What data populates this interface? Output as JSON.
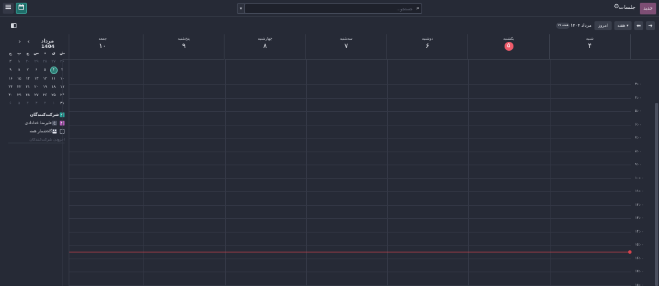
{
  "topbar": {
    "new_label": "جدید",
    "app_title": "جلسات",
    "settings_icon": "gear-icon",
    "search_placeholder": "جستجو...",
    "search_icon": "search-icon",
    "search_toggle_icon": "caret-down-icon",
    "views": [
      {
        "name": "calendar-view",
        "icon": "calendar-icon",
        "active": true
      },
      {
        "name": "list-view",
        "icon": "list-icon",
        "active": false
      }
    ]
  },
  "controls": {
    "prev_icon": "arrow-left-icon",
    "next_icon": "arrow-right-icon",
    "scale_label": "هفته",
    "today_label": "امروز",
    "range_label": "مرداد ۱۴۰۴",
    "week_badge": "هفته ۱۹",
    "sidebar_toggle_icon": "sidebar-toggle-icon"
  },
  "mini_calendar": {
    "title": "مرداد 1404",
    "weekday_heads": [
      "ش",
      "ی",
      "د",
      "س",
      "چ",
      "پ",
      "ج"
    ],
    "weeks": [
      [
        "۲۶",
        "۲۷",
        "۲۸",
        "۲۹",
        "۳۰",
        "۱",
        "۲"
      ],
      [
        "۳",
        "۴",
        "۵",
        "۶",
        "۷",
        "۸",
        "۹"
      ],
      [
        "۱۰",
        "۱۱",
        "۱۲",
        "۱۳",
        "۱۴",
        "۱۵",
        "۱۶"
      ],
      [
        "۱۷",
        "۱۸",
        "۱۹",
        "۲۰",
        "۲۱",
        "۲۲",
        "۲۳"
      ],
      [
        "۲۴",
        "۲۵",
        "۲۶",
        "۲۷",
        "۲۸",
        "۲۹",
        "۳۰"
      ],
      [
        "۳۱",
        "۱",
        "۲",
        "۳",
        "۴",
        "۵",
        "۶"
      ]
    ],
    "muted": [
      [
        0,
        0
      ],
      [
        0,
        1
      ],
      [
        0,
        2
      ],
      [
        0,
        3
      ],
      [
        0,
        4
      ],
      [
        5,
        1
      ],
      [
        5,
        2
      ],
      [
        5,
        3
      ],
      [
        5,
        4
      ],
      [
        5,
        5
      ],
      [
        5,
        6
      ]
    ],
    "today": [
      1,
      1
    ]
  },
  "attendees": {
    "header": "شرکت‌کنندگان",
    "items": [
      {
        "label": "علیرضا خداداد‌ی",
        "avatar": "ع"
      },
      {
        "label": "گاه‌شمار همه",
        "avatar_icon": "group-icon"
      }
    ],
    "add_placeholder": "افزودن شرکت‌کنندگان"
  },
  "calendar": {
    "days": [
      {
        "name": "شنبه",
        "num": "۴",
        "today": false
      },
      {
        "name": "یکشنبه",
        "num": "۵",
        "today": true
      },
      {
        "name": "دوشنبه",
        "num": "۶",
        "today": false
      },
      {
        "name": "سه‌شنبه",
        "num": "۷",
        "today": false
      },
      {
        "name": "چهارشنبه",
        "num": "۸",
        "today": false
      },
      {
        "name": "پنج‌شنبه",
        "num": "۹",
        "today": false
      },
      {
        "name": "جمعه",
        "num": "۱۰",
        "today": false
      }
    ],
    "hours": [
      "۳:۰۰",
      "۴:۰۰",
      "۵:۰۰",
      "۶:۰۰",
      "۷:۰۰",
      "۸:۰۰",
      "۹:۰۰",
      "۱۰:۰۰",
      "۱۱:۰۰",
      "۱۲:۰۰",
      "۱۳:۰۰",
      "۱۴:۰۰",
      "۱۵:۰۰",
      "۱۶:۰۰",
      "۱۷:۰۰",
      "۱۸:۰۰"
    ]
  },
  "colors": {
    "background": "#262a36",
    "new_button": "#7d4e74",
    "today_marker": "#ef5b6b",
    "now_line": "#d8434d",
    "accent_teal": "#2aa198",
    "accent_purple": "#b05bb5"
  }
}
